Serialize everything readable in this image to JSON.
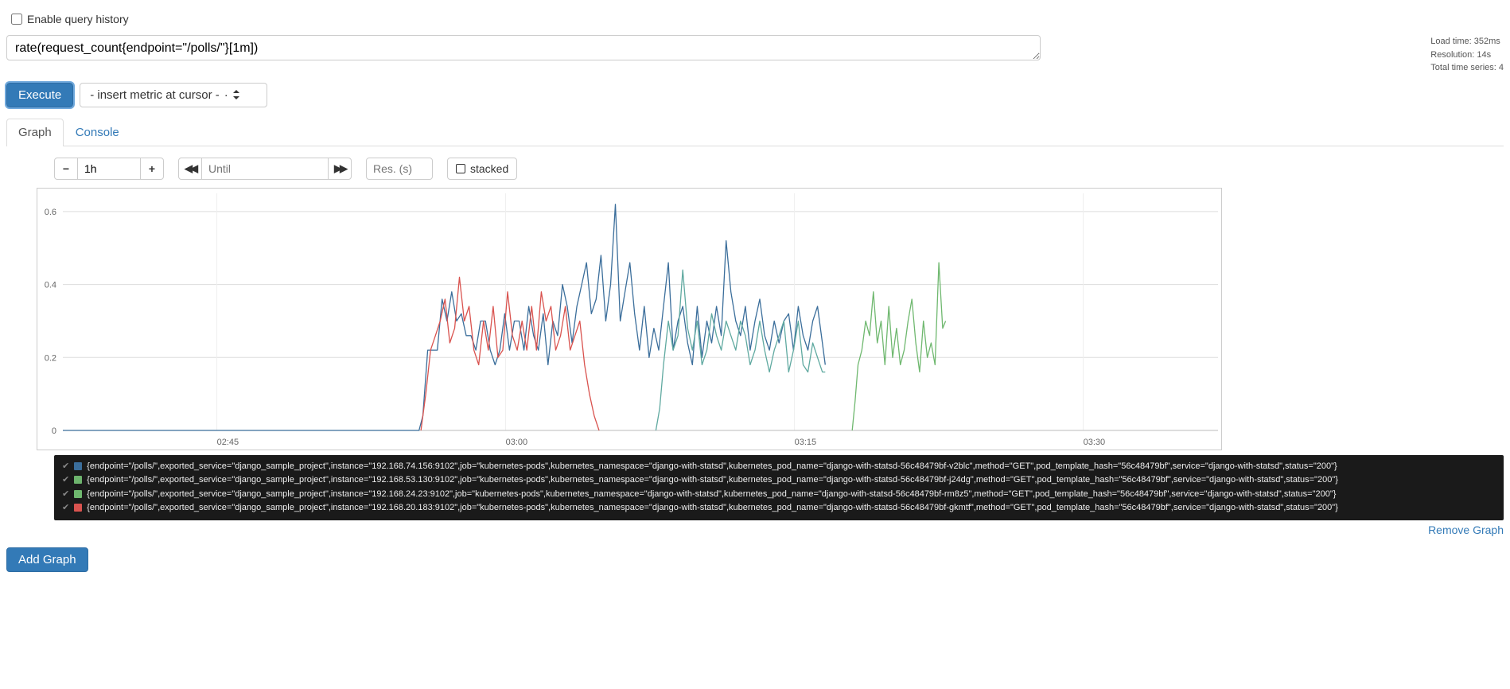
{
  "enable_history_label": "Enable query history",
  "query": "rate(request_count{endpoint=\"/polls/\"}[1m])",
  "stats": {
    "load_time": "Load time: 352ms",
    "resolution": "Resolution: 14s",
    "total_series": "Total time series: 4"
  },
  "execute_label": "Execute",
  "metric_dropdown_label": "- insert metric at cursor -",
  "tabs": {
    "graph": "Graph",
    "console": "Console"
  },
  "range_controls": {
    "range_value": "1h",
    "until_placeholder": "Until",
    "res_placeholder": "Res. (s)",
    "stacked_label": "stacked"
  },
  "remove_graph_label": "Remove Graph",
  "add_graph_label": "Add Graph",
  "colors": {
    "series1": "#3b6e9b",
    "series2": "#6db36d",
    "series3": "#6fb86f",
    "series4": "#d9534f"
  },
  "legend": [
    {
      "color": "#3b6e9b",
      "text": "{endpoint=\"/polls/\",exported_service=\"django_sample_project\",instance=\"192.168.74.156:9102\",job=\"kubernetes-pods\",kubernetes_namespace=\"django-with-statsd\",kubernetes_pod_name=\"django-with-statsd-56c48479bf-v2blc\",method=\"GET\",pod_template_hash=\"56c48479bf\",service=\"django-with-statsd\",status=\"200\"}"
    },
    {
      "color": "#6db36d",
      "text": "{endpoint=\"/polls/\",exported_service=\"django_sample_project\",instance=\"192.168.53.130:9102\",job=\"kubernetes-pods\",kubernetes_namespace=\"django-with-statsd\",kubernetes_pod_name=\"django-with-statsd-56c48479bf-j24dg\",method=\"GET\",pod_template_hash=\"56c48479bf\",service=\"django-with-statsd\",status=\"200\"}"
    },
    {
      "color": "#6fb86f",
      "text": "{endpoint=\"/polls/\",exported_service=\"django_sample_project\",instance=\"192.168.24.23:9102\",job=\"kubernetes-pods\",kubernetes_namespace=\"django-with-statsd\",kubernetes_pod_name=\"django-with-statsd-56c48479bf-rm8z5\",method=\"GET\",pod_template_hash=\"56c48479bf\",service=\"django-with-statsd\",status=\"200\"}"
    },
    {
      "color": "#d9534f",
      "text": "{endpoint=\"/polls/\",exported_service=\"django_sample_project\",instance=\"192.168.20.183:9102\",job=\"kubernetes-pods\",kubernetes_namespace=\"django-with-statsd\",kubernetes_pod_name=\"django-with-statsd-56c48479bf-gkmtf\",method=\"GET\",pod_template_hash=\"56c48479bf\",service=\"django-with-statsd\",status=\"200\"}"
    }
  ],
  "chart_data": {
    "type": "line",
    "xlabel": "",
    "ylabel": "",
    "ylim": [
      0,
      0.65
    ],
    "y_ticks": [
      0,
      0.2,
      0.4,
      0.6
    ],
    "x_ticks": [
      "02:45",
      "03:00",
      "03:15",
      "03:30"
    ],
    "x_range_minutes": [
      37,
      37.95
    ],
    "series": [
      {
        "name": "blue",
        "color": "#3b6e9b",
        "points": [
          [
            37,
            0
          ],
          [
            55.5,
            0
          ],
          [
            55.7,
            0.04
          ],
          [
            55.95,
            0.22
          ],
          [
            56.2,
            0.22
          ],
          [
            56.45,
            0.22
          ],
          [
            56.7,
            0.36
          ],
          [
            56.95,
            0.3
          ],
          [
            57.2,
            0.38
          ],
          [
            57.45,
            0.3
          ],
          [
            57.7,
            0.32
          ],
          [
            57.95,
            0.26
          ],
          [
            58.2,
            0.26
          ],
          [
            58.45,
            0.22
          ],
          [
            58.7,
            0.3
          ],
          [
            58.95,
            0.3
          ],
          [
            59.2,
            0.22
          ],
          [
            59.45,
            0.18
          ],
          [
            59.7,
            0.22
          ],
          [
            59.95,
            0.32
          ],
          [
            60.2,
            0.22
          ],
          [
            60.45,
            0.3
          ],
          [
            60.7,
            0.3
          ],
          [
            60.95,
            0.22
          ],
          [
            61.2,
            0.34
          ],
          [
            61.45,
            0.26
          ],
          [
            61.7,
            0.22
          ],
          [
            61.95,
            0.32
          ],
          [
            62.2,
            0.18
          ],
          [
            62.45,
            0.3
          ],
          [
            62.7,
            0.26
          ],
          [
            62.95,
            0.4
          ],
          [
            63.2,
            0.34
          ],
          [
            63.45,
            0.24
          ],
          [
            63.7,
            0.34
          ],
          [
            63.95,
            0.4
          ],
          [
            64.2,
            0.46
          ],
          [
            64.45,
            0.32
          ],
          [
            64.7,
            0.36
          ],
          [
            64.95,
            0.48
          ],
          [
            65.2,
            0.3
          ],
          [
            65.45,
            0.4
          ],
          [
            65.7,
            0.62
          ],
          [
            65.95,
            0.3
          ],
          [
            66.2,
            0.38
          ],
          [
            66.45,
            0.46
          ],
          [
            66.7,
            0.32
          ],
          [
            66.95,
            0.22
          ],
          [
            67.2,
            0.34
          ],
          [
            67.45,
            0.2
          ],
          [
            67.7,
            0.28
          ],
          [
            67.95,
            0.22
          ],
          [
            68.2,
            0.34
          ],
          [
            68.45,
            0.46
          ],
          [
            68.7,
            0.22
          ],
          [
            68.95,
            0.3
          ],
          [
            69.2,
            0.34
          ],
          [
            69.45,
            0.24
          ],
          [
            69.7,
            0.18
          ],
          [
            69.95,
            0.34
          ],
          [
            70.2,
            0.2
          ],
          [
            70.45,
            0.3
          ],
          [
            70.7,
            0.24
          ],
          [
            70.95,
            0.34
          ],
          [
            71.2,
            0.26
          ],
          [
            71.45,
            0.52
          ],
          [
            71.7,
            0.38
          ],
          [
            71.95,
            0.3
          ],
          [
            72.2,
            0.26
          ],
          [
            72.45,
            0.34
          ],
          [
            72.7,
            0.22
          ],
          [
            72.95,
            0.3
          ],
          [
            73.2,
            0.36
          ],
          [
            73.45,
            0.26
          ],
          [
            73.7,
            0.22
          ],
          [
            73.95,
            0.3
          ],
          [
            74.2,
            0.24
          ],
          [
            74.45,
            0.3
          ],
          [
            74.7,
            0.32
          ],
          [
            74.95,
            0.22
          ],
          [
            75.2,
            0.34
          ],
          [
            75.45,
            0.26
          ],
          [
            75.7,
            0.22
          ],
          [
            75.95,
            0.3
          ],
          [
            76.2,
            0.34
          ],
          [
            76.45,
            0.24
          ],
          [
            76.6,
            0.18
          ]
        ]
      },
      {
        "name": "red",
        "color": "#d9534f",
        "points": [
          [
            55.6,
            0.0
          ],
          [
            55.85,
            0.1
          ],
          [
            56.1,
            0.22
          ],
          [
            56.35,
            0.26
          ],
          [
            56.6,
            0.3
          ],
          [
            56.85,
            0.36
          ],
          [
            57.1,
            0.24
          ],
          [
            57.35,
            0.28
          ],
          [
            57.6,
            0.42
          ],
          [
            57.85,
            0.3
          ],
          [
            58.1,
            0.34
          ],
          [
            58.35,
            0.22
          ],
          [
            58.6,
            0.18
          ],
          [
            58.85,
            0.3
          ],
          [
            59.1,
            0.22
          ],
          [
            59.35,
            0.34
          ],
          [
            59.6,
            0.2
          ],
          [
            59.85,
            0.22
          ],
          [
            60.1,
            0.38
          ],
          [
            60.35,
            0.26
          ],
          [
            60.6,
            0.22
          ],
          [
            60.85,
            0.3
          ],
          [
            61.1,
            0.22
          ],
          [
            61.35,
            0.34
          ],
          [
            61.6,
            0.22
          ],
          [
            61.85,
            0.38
          ],
          [
            62.1,
            0.3
          ],
          [
            62.35,
            0.34
          ],
          [
            62.6,
            0.22
          ],
          [
            62.85,
            0.26
          ],
          [
            63.1,
            0.34
          ],
          [
            63.35,
            0.22
          ],
          [
            63.6,
            0.26
          ],
          [
            63.85,
            0.3
          ],
          [
            64.1,
            0.18
          ],
          [
            64.35,
            0.1
          ],
          [
            64.6,
            0.04
          ],
          [
            64.85,
            0.0
          ]
        ]
      },
      {
        "name": "teal",
        "color": "#5fa9a0",
        "points": [
          [
            67.8,
            0.0
          ],
          [
            68.0,
            0.06
          ],
          [
            68.2,
            0.18
          ],
          [
            68.45,
            0.3
          ],
          [
            68.7,
            0.22
          ],
          [
            68.95,
            0.26
          ],
          [
            69.2,
            0.44
          ],
          [
            69.45,
            0.28
          ],
          [
            69.7,
            0.22
          ],
          [
            69.95,
            0.3
          ],
          [
            70.2,
            0.18
          ],
          [
            70.45,
            0.22
          ],
          [
            70.7,
            0.32
          ],
          [
            70.95,
            0.26
          ],
          [
            71.2,
            0.22
          ],
          [
            71.45,
            0.3
          ],
          [
            71.7,
            0.26
          ],
          [
            71.95,
            0.22
          ],
          [
            72.2,
            0.3
          ],
          [
            72.45,
            0.26
          ],
          [
            72.7,
            0.18
          ],
          [
            72.95,
            0.22
          ],
          [
            73.2,
            0.3
          ],
          [
            73.45,
            0.22
          ],
          [
            73.7,
            0.16
          ],
          [
            73.95,
            0.22
          ],
          [
            74.2,
            0.26
          ],
          [
            74.45,
            0.3
          ],
          [
            74.7,
            0.16
          ],
          [
            74.95,
            0.22
          ],
          [
            75.2,
            0.3
          ],
          [
            75.45,
            0.18
          ],
          [
            75.7,
            0.16
          ],
          [
            75.95,
            0.24
          ],
          [
            76.2,
            0.2
          ],
          [
            76.45,
            0.16
          ],
          [
            76.6,
            0.16
          ]
        ]
      },
      {
        "name": "green",
        "color": "#6fb86f",
        "points": [
          [
            78.0,
            0.0
          ],
          [
            78.15,
            0.08
          ],
          [
            78.3,
            0.18
          ],
          [
            78.5,
            0.22
          ],
          [
            78.7,
            0.3
          ],
          [
            78.9,
            0.26
          ],
          [
            79.1,
            0.38
          ],
          [
            79.3,
            0.24
          ],
          [
            79.5,
            0.3
          ],
          [
            79.7,
            0.18
          ],
          [
            79.9,
            0.34
          ],
          [
            80.1,
            0.2
          ],
          [
            80.3,
            0.28
          ],
          [
            80.5,
            0.18
          ],
          [
            80.7,
            0.22
          ],
          [
            80.9,
            0.3
          ],
          [
            81.1,
            0.36
          ],
          [
            81.3,
            0.24
          ],
          [
            81.5,
            0.16
          ],
          [
            81.7,
            0.3
          ],
          [
            81.9,
            0.2
          ],
          [
            82.1,
            0.24
          ],
          [
            82.3,
            0.18
          ],
          [
            82.5,
            0.46
          ],
          [
            82.7,
            0.28
          ],
          [
            82.85,
            0.3
          ]
        ]
      }
    ]
  }
}
